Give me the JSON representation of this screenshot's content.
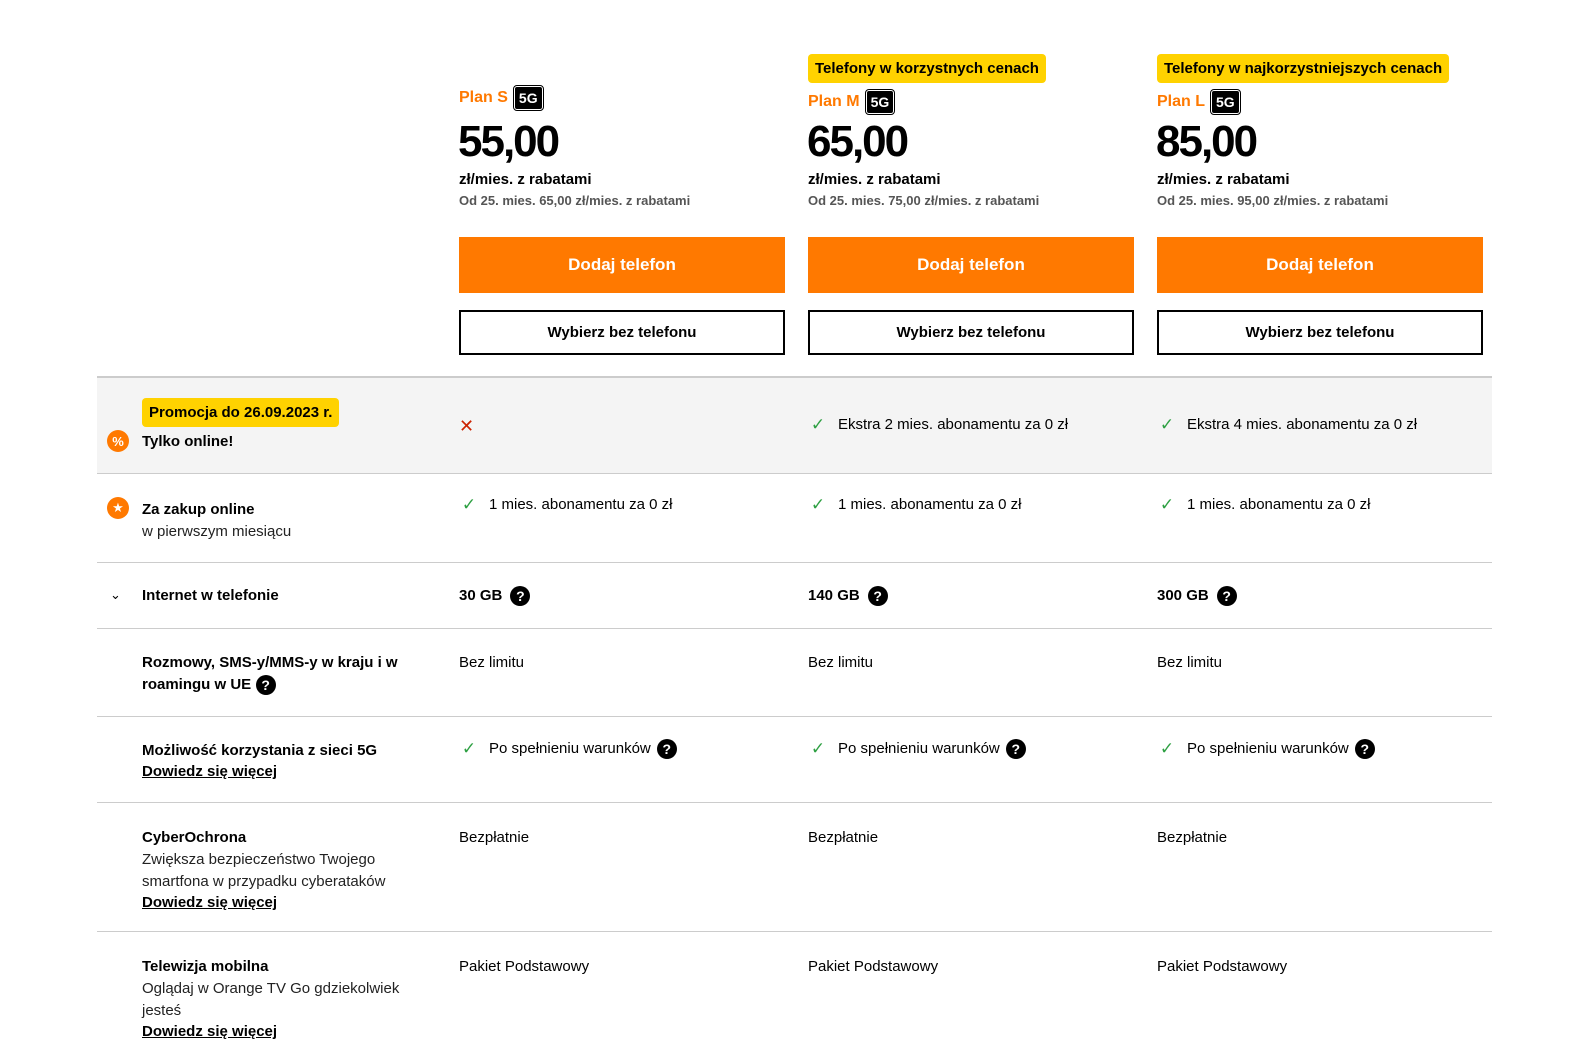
{
  "plans": [
    {
      "badge": "",
      "name": "Plan S",
      "tag": "5G",
      "price": "55,00",
      "price_unit": "zł/mies. z rabatami",
      "price_later": "Od 25. mies. 65,00 zł/mies. z rabatami",
      "primary_button": "Dodaj telefon",
      "secondary_button": "Wybierz bez telefonu"
    },
    {
      "badge": "Telefony w korzystnych cenach",
      "name": "Plan M",
      "tag": "5G",
      "price": "65,00",
      "price_unit": "zł/mies. z rabatami",
      "price_later": "Od 25. mies. 75,00 zł/mies. z rabatami",
      "primary_button": "Dodaj telefon",
      "secondary_button": "Wybierz bez telefonu"
    },
    {
      "badge": "Telefony w najkorzystniejszych cenach",
      "name": "Plan L",
      "tag": "5G",
      "price": "85,00",
      "price_unit": "zł/mies. z rabatami",
      "price_later": "Od 25. mies. 95,00 zł/mies. z rabatami",
      "primary_button": "Dodaj telefon",
      "secondary_button": "Wybierz bez telefonu"
    }
  ],
  "rows": {
    "promo": {
      "badge": "Promocja do 26.09.2023 r.",
      "label": "Tylko online!",
      "icon": "percent-icon",
      "values": [
        "",
        "Ekstra 2 mies. abonamentu za 0 zł",
        "Ekstra 4 mies. abonamentu za 0 zł"
      ]
    },
    "online": {
      "label": "Za zakup online",
      "sublabel": "w pierwszym miesiącu",
      "icon": "star-icon",
      "values": [
        "1 mies. abonamentu za 0 zł",
        "1 mies. abonamentu za 0 zł",
        "1 mies. abonamentu za 0 zł"
      ]
    },
    "internet": {
      "label": "Internet w telefonie",
      "values": [
        "30 GB",
        "140 GB",
        "300 GB"
      ]
    },
    "calls": {
      "label": "Rozmowy, SMS-y/MMS-y w kraju i w roamingu w UE",
      "values": [
        "Bez limitu",
        "Bez limitu",
        "Bez limitu"
      ]
    },
    "net5g": {
      "label": "Możliwość korzystania z sieci 5G",
      "link": "Dowiedz się więcej",
      "values": [
        "Po spełnieniu warunków",
        "Po spełnieniu warunków",
        "Po spełnieniu warunków"
      ]
    },
    "cyber": {
      "label": "CyberOchrona",
      "sublabel": "Zwiększa bezpieczeństwo Twojego smartfona w przypadku cyberataków",
      "link": "Dowiedz się więcej",
      "values": [
        "Bezpłatnie",
        "Bezpłatnie",
        "Bezpłatnie"
      ]
    },
    "tv": {
      "label": "Telewizja mobilna",
      "sublabel": "Oglądaj w Orange TV Go gdziekolwiek jesteś",
      "link": "Dowiedz się więcej",
      "values": [
        "Pakiet Podstawowy",
        "Pakiet Podstawowy",
        "Pakiet Podstawowy"
      ]
    }
  },
  "colors": {
    "accent": "#ff7900",
    "badge": "#ffd200",
    "check": "#2ea043",
    "cross": "#cc2200"
  }
}
